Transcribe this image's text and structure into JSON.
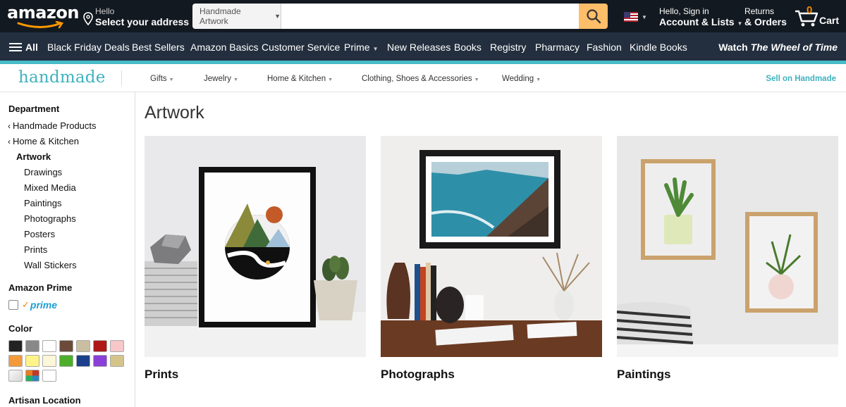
{
  "header": {
    "logo": "amazon",
    "deliver_line1": "Hello",
    "deliver_line2": "Select your address",
    "search_category": "Handmade Artwork",
    "search_value": "",
    "account_line1": "Hello, Sign in",
    "account_line2": "Account & Lists",
    "returns_line1": "Returns",
    "returns_line2": "& Orders",
    "cart_count": "0",
    "cart_label": "Cart",
    "accent": "#febd69",
    "nav_bg": "#131921"
  },
  "subnav": {
    "all_label": "All",
    "items": [
      "Black Friday Deals",
      "Best Sellers",
      "Amazon Basics",
      "Customer Service",
      "Prime",
      "New Releases",
      "Books",
      "Registry",
      "Pharmacy",
      "Fashion",
      "Kindle Books"
    ],
    "promo_prefix": "Watch ",
    "promo_title": "The Wheel of Time"
  },
  "handmade": {
    "logo": "handmade",
    "brand_color": "#3fb2bf",
    "nav": [
      "Gifts",
      "Jewelry",
      "Home & Kitchen",
      "Clothing, Shoes & Accessories",
      "Wedding"
    ],
    "sell_label": "Sell on Handmade"
  },
  "sidebar": {
    "department_heading": "Department",
    "parents": [
      "Handmade Products",
      "Home & Kitchen"
    ],
    "current": "Artwork",
    "children": [
      "Drawings",
      "Mixed Media",
      "Paintings",
      "Photographs",
      "Posters",
      "Prints",
      "Wall Stickers"
    ],
    "prime_heading": "Amazon Prime",
    "prime_label": "prime",
    "color_heading": "Color",
    "colors": [
      "#222222",
      "#888888",
      "#ffffff",
      "#6b4a3a",
      "#c9bfa0",
      "#b01818",
      "#f7c7c9",
      "#f39a3a",
      "#fff38a",
      "#fbf7d8",
      "#4cae2b",
      "#1b3f8c",
      "#8a3fd8",
      "#d4c48a",
      "#f0f0f0",
      "multicolor",
      "#ffffff"
    ],
    "artisan_heading": "Artisan Location"
  },
  "main": {
    "title": "Artwork",
    "cards": [
      {
        "label": "Prints"
      },
      {
        "label": "Photographs"
      },
      {
        "label": "Paintings"
      }
    ]
  }
}
